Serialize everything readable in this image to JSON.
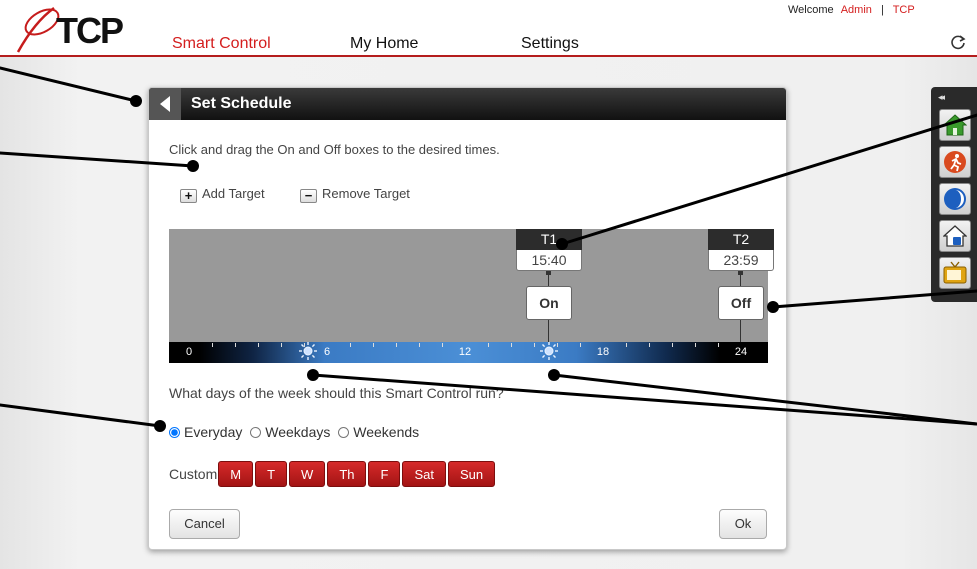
{
  "header": {
    "logo_text": "TCP",
    "nav": [
      "Smart Control",
      "My Home",
      "Settings"
    ],
    "welcome_text": "Welcome",
    "user": "Admin",
    "separator": "|",
    "brand_link": "TCP"
  },
  "dialog": {
    "title": "Set Schedule",
    "instructions": "Click and drag the On and Off boxes to the desired times.",
    "add_target": "Add Target",
    "remove_target": "Remove Target",
    "timeline": {
      "ticks": [
        "0",
        "6",
        "12",
        "18",
        "24"
      ],
      "targets": [
        {
          "label": "T1",
          "time": "15:40",
          "state": "On"
        },
        {
          "label": "T2",
          "time": "23:59",
          "state": "Off"
        }
      ]
    },
    "days_question": "What days of the week should this Smart Control run?",
    "day_options": [
      "Everyday",
      "Weekdays",
      "Weekends"
    ],
    "selected_option": "Everyday",
    "custom_label": "Custom",
    "days": [
      "M",
      "T",
      "W",
      "Th",
      "F",
      "Sat",
      "Sun"
    ],
    "cancel": "Cancel",
    "ok": "Ok"
  },
  "toolbar": {
    "collapse": "◂◂",
    "icons": [
      "home-icon",
      "running-man-icon",
      "moon-icon",
      "house-lock-icon",
      "tv-icon"
    ]
  },
  "colors": {
    "brand_red": "#d41e1e",
    "day_button": "#b81b1b",
    "dialog_header": "#1e1e1e",
    "timeline_bg": "#999999",
    "timebar_blue": "#4b8fd6"
  }
}
